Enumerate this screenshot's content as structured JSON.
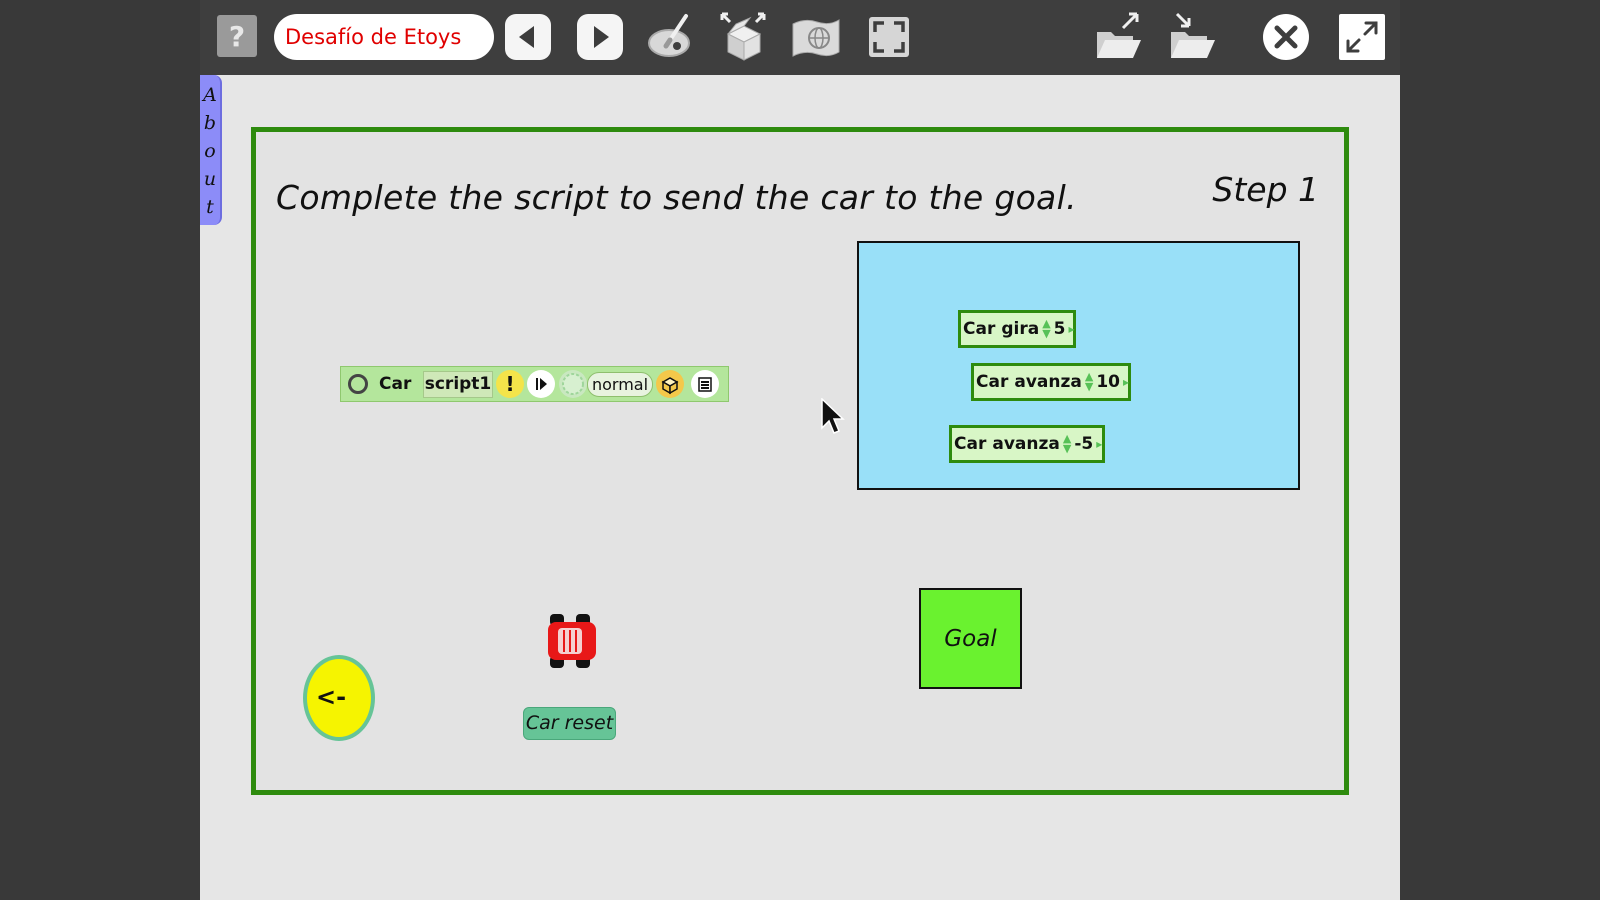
{
  "toolbar": {
    "help_label": "?",
    "project_name": "Desafío de Etoys",
    "icons": [
      "help-icon",
      "previous-page-icon",
      "next-page-icon",
      "paint-icon",
      "supplies-icon",
      "globe-icon",
      "fullscreen-frame-icon",
      "load-project-icon",
      "save-project-icon",
      "close-icon",
      "expand-icon"
    ]
  },
  "flap": {
    "letters": [
      "A",
      "b",
      "o",
      "u",
      "t"
    ]
  },
  "book": {
    "instruction": "Complete the script to send the car to the goal.",
    "step": "Step 1"
  },
  "script_editor": {
    "player": "Car",
    "script_name": "script1",
    "bang": "!",
    "tick_rate": "normal"
  },
  "tiles": [
    {
      "player": "Car",
      "command": "gira",
      "value": "5"
    },
    {
      "player": "Car",
      "command": "avanza",
      "value": "10"
    },
    {
      "player": "Car",
      "command": "avanza",
      "value": "-5"
    }
  ],
  "goal_label": "Goal",
  "car_reset_label": "Car reset",
  "back_button_label": "<-",
  "colors": {
    "book_border": "#2e8b0e",
    "panel": "#99e0f8",
    "goal": "#6af22f",
    "reset_button": "#66c497",
    "about_flap": "#8c8cf8",
    "project_name_text": "#e00000"
  }
}
